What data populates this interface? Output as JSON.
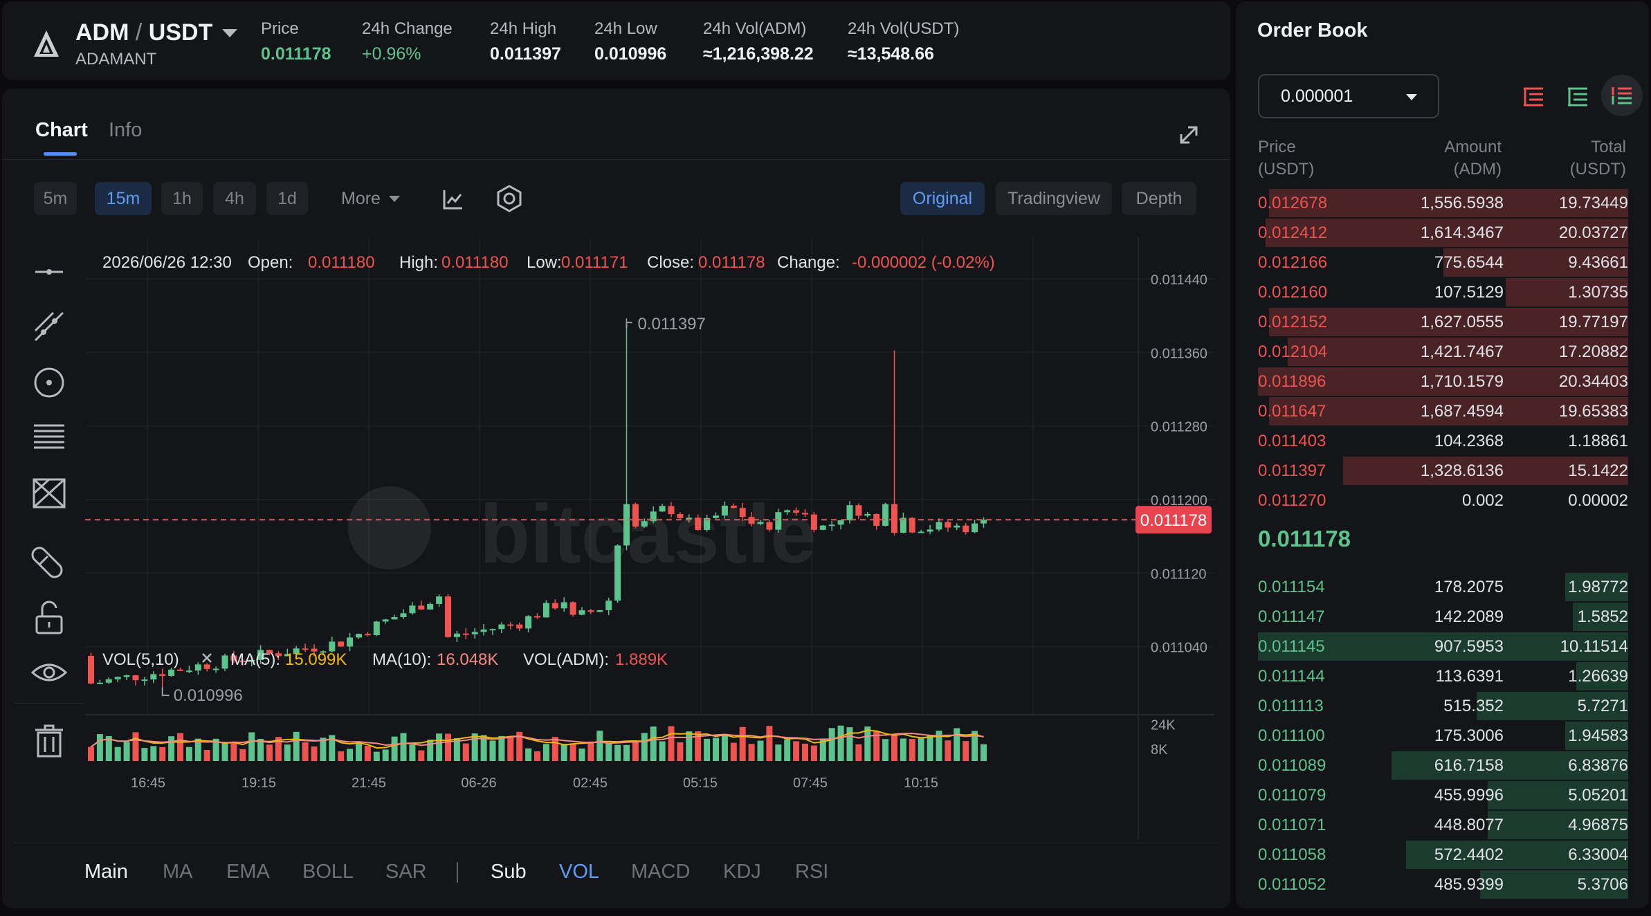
{
  "ticker": {
    "base": "ADM",
    "separator": "/",
    "quote": "USDT",
    "coin_name": "ADAMANT",
    "stats": [
      {
        "label": "Price",
        "value": "0.011178",
        "color": "green"
      },
      {
        "label": "24h Change",
        "value": "+0.96%",
        "color": "green-light"
      },
      {
        "label": "24h High",
        "value": "0.011397",
        "color": "white"
      },
      {
        "label": "24h Low",
        "value": "0.010996",
        "color": "white"
      },
      {
        "label": "24h Vol(ADM)",
        "value": "≈1,216,398.22",
        "color": "white"
      },
      {
        "label": "24h Vol(USDT)",
        "value": "≈13,548.66",
        "color": "white"
      }
    ]
  },
  "chart_panel": {
    "tabs": [
      {
        "label": "Chart",
        "active": true
      },
      {
        "label": "Info",
        "active": false
      }
    ],
    "timeframes": [
      {
        "label": "5m",
        "active": false
      },
      {
        "label": "15m",
        "active": true
      },
      {
        "label": "1h",
        "active": false
      },
      {
        "label": "4h",
        "active": false
      },
      {
        "label": "1d",
        "active": false
      }
    ],
    "more_label": "More",
    "views": [
      {
        "label": "Original",
        "active": true
      },
      {
        "label": "Tradingview",
        "active": false
      },
      {
        "label": "Depth",
        "active": false
      }
    ],
    "side_tools": [
      "horizontal-line-icon",
      "trend-line-icon",
      "circle-target-icon",
      "fibonacci-icon",
      "pattern-icon",
      "magnet-icon",
      "unlock-icon",
      "eye-icon",
      "trash-icon"
    ],
    "ohlc": {
      "date": "2026/06/26 12:30",
      "open_label": "Open:",
      "open": "0.011180",
      "high_label": "High:",
      "high": "0.011180",
      "low_label": "Low:",
      "low": "0.011171",
      "close_label": "Close:",
      "close": "0.011178",
      "change_label": "Change:",
      "change": "-0.000002 (-0.02%)"
    },
    "vol_legend": {
      "name": "VOL(5,10)",
      "ma5_label": "MA(5):",
      "ma5": "15.099K",
      "ma10_label": "MA(10):",
      "ma10": "16.048K",
      "vol_label": "VOL(ADM):",
      "vol": "1.889K"
    },
    "watermark": "bitcastle",
    "indicators_main": [
      {
        "label": "Main",
        "active": true
      },
      {
        "label": "MA",
        "active": false
      },
      {
        "label": "EMA",
        "active": false
      },
      {
        "label": "BOLL",
        "active": false
      },
      {
        "label": "SAR",
        "active": false
      }
    ],
    "indicators_sub": [
      {
        "label": "Sub",
        "active": true
      },
      {
        "label": "VOL",
        "active": true
      },
      {
        "label": "MACD",
        "active": false
      },
      {
        "label": "KDJ",
        "active": false
      },
      {
        "label": "RSI",
        "active": false
      }
    ]
  },
  "chart_data": {
    "type": "candlestick",
    "y_ticks": [
      "0.011440",
      "0.011360",
      "0.011280",
      "0.011200",
      "0.011120",
      "0.011040"
    ],
    "y_tick_values": [
      0.01144,
      0.01136,
      0.01128,
      0.0112,
      0.01112,
      0.01104
    ],
    "vol_ticks": [
      "24K",
      "8K"
    ],
    "vol_tick_values": [
      24000,
      8000
    ],
    "x_ticks": [
      "16:45",
      "19:15",
      "21:45",
      "06-26",
      "02:45",
      "05:15",
      "07:45",
      "10:15"
    ],
    "current_price": "0.011178",
    "current_price_value": 0.011178,
    "high_marker": "0.011397",
    "high_value": 0.011397,
    "low_marker": "0.010996",
    "low_value": 0.010996,
    "ylim": [
      0.010966,
      0.011455
    ],
    "volume_ylim": [
      0,
      30000
    ],
    "colors": {
      "up": "#5cc38c",
      "down": "#ef5350",
      "ma5": "#f0b90b",
      "ma10": "#f28b82"
    }
  },
  "orderbook": {
    "title": "Order Book",
    "precision": "0.000001",
    "headers": {
      "price": "Price",
      "price_unit": "(USDT)",
      "amount": "Amount",
      "amount_unit": "(ADM)",
      "total": "Total",
      "total_unit": "(USDT)"
    },
    "asks": [
      {
        "price": "0.012678",
        "amount": "1,556.5938",
        "total": "19.73449",
        "depth": 0.97
      },
      {
        "price": "0.012412",
        "amount": "1,614.3467",
        "total": "20.03727",
        "depth": 0.98
      },
      {
        "price": "0.012166",
        "amount": "775.6544",
        "total": "9.43661",
        "depth": 0.5
      },
      {
        "price": "0.012160",
        "amount": "107.5129",
        "total": "1.30735",
        "depth": 0.33
      },
      {
        "price": "0.012152",
        "amount": "1,627.0555",
        "total": "19.77197",
        "depth": 0.97
      },
      {
        "price": "0.012104",
        "amount": "1,421.7467",
        "total": "17.20882",
        "depth": 0.92
      },
      {
        "price": "0.011896",
        "amount": "1,710.1579",
        "total": "20.34403",
        "depth": 1.0
      },
      {
        "price": "0.011647",
        "amount": "1,687.4594",
        "total": "19.65383",
        "depth": 0.97
      },
      {
        "price": "0.011403",
        "amount": "104.2368",
        "total": "1.18861",
        "depth": 0.0
      },
      {
        "price": "0.011397",
        "amount": "1,328.6136",
        "total": "15.1422",
        "depth": 0.77
      },
      {
        "price": "0.011270",
        "amount": "0.002",
        "total": "0.00002",
        "depth": 0.0
      }
    ],
    "last_price": "0.011178",
    "bids": [
      {
        "price": "0.011154",
        "amount": "178.2075",
        "total": "1.98772",
        "depth": 0.17
      },
      {
        "price": "0.011147",
        "amount": "142.2089",
        "total": "1.5852",
        "depth": 0.15
      },
      {
        "price": "0.011145",
        "amount": "907.5953",
        "total": "10.11514",
        "depth": 1.0
      },
      {
        "price": "0.011144",
        "amount": "113.6391",
        "total": "1.26639",
        "depth": 0.14
      },
      {
        "price": "0.011113",
        "amount": "515.352",
        "total": "5.7271",
        "depth": 0.41
      },
      {
        "price": "0.011100",
        "amount": "175.3006",
        "total": "1.94583",
        "depth": 0.17
      },
      {
        "price": "0.011089",
        "amount": "616.7158",
        "total": "6.83876",
        "depth": 0.64
      },
      {
        "price": "0.011079",
        "amount": "455.9996",
        "total": "5.05201",
        "depth": 0.38
      },
      {
        "price": "0.011071",
        "amount": "448.8077",
        "total": "4.96875",
        "depth": 0.38
      },
      {
        "price": "0.011058",
        "amount": "572.4402",
        "total": "6.33004",
        "depth": 0.6
      },
      {
        "price": "0.011052",
        "amount": "485.9399",
        "total": "5.3706",
        "depth": 0.4
      }
    ]
  }
}
